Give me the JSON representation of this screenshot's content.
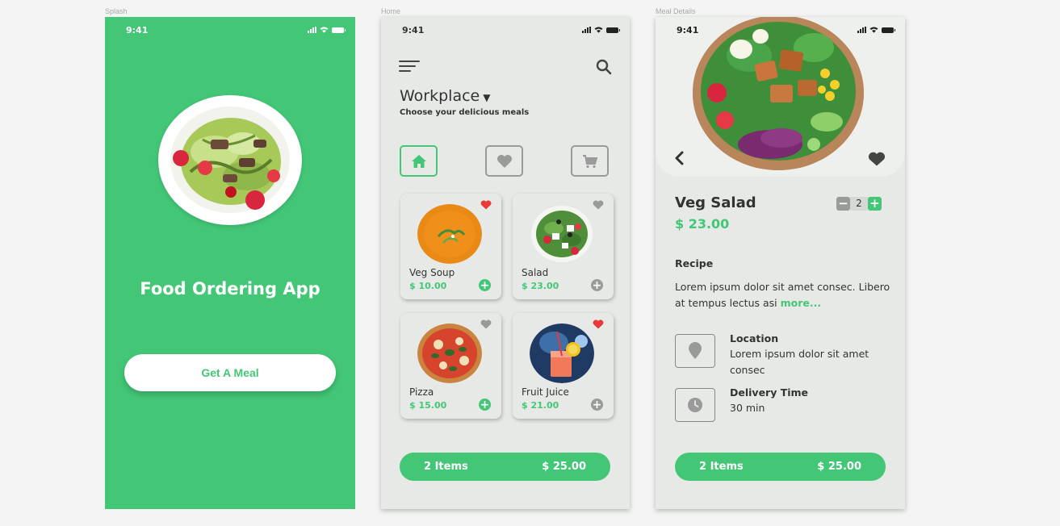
{
  "labels": {
    "splash": "Splash",
    "home": "Home",
    "details": "Meal Details"
  },
  "status": {
    "time": "9:41"
  },
  "splash": {
    "title": "Food Ordering App",
    "cta": "Get  A Meal"
  },
  "home": {
    "workplace": "Workplace",
    "caret": "▼",
    "subtitle": "Choose your delicious  meals",
    "items": [
      {
        "name": "Veg Soup",
        "price": "$ 10.00",
        "favorite": true
      },
      {
        "name": "Salad",
        "price": "$ 23.00",
        "favorite": false
      },
      {
        "name": "Pizza",
        "price": "$ 15.00",
        "favorite": false
      },
      {
        "name": "Fruit Juice",
        "price": "$ 21.00",
        "favorite": true
      }
    ],
    "cart": {
      "count": "2 Items",
      "total": "$ 25.00"
    }
  },
  "details": {
    "name": "Veg Salad",
    "price": "$ 23.00",
    "quantity": "2",
    "recipe_heading": "Recipe",
    "recipe_text": "Lorem ipsum dolor sit amet consec. Libero at tempus lectus asi ",
    "recipe_more": "more...",
    "location_heading": "Location",
    "location_text": "Lorem ipsum dolor sit amet consec",
    "delivery_heading": "Delivery Time",
    "delivery_text": "30 min",
    "cart": {
      "count": "2 Items",
      "total": "$ 25.00"
    }
  },
  "colors": {
    "accent": "#43c777",
    "favorite": "#e83a3a",
    "inactive": "#9a9a9a"
  }
}
